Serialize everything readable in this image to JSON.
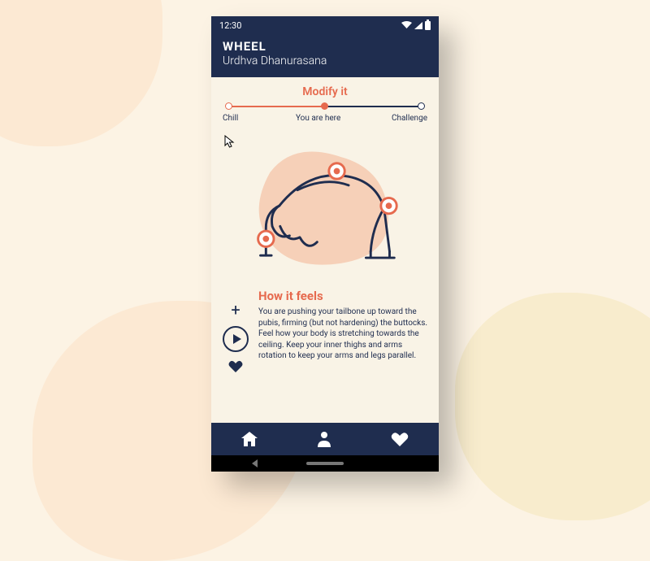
{
  "statusbar": {
    "time": "12:30"
  },
  "header": {
    "title": "WHEEL",
    "subtitle": "Urdhva Dhanurasana"
  },
  "difficulty": {
    "title": "Modify it",
    "labels": {
      "low": "Chill",
      "mid": "You are here",
      "high": "Challenge"
    }
  },
  "feels": {
    "heading": "How it feels",
    "body": "You are pushing your tailbone up toward the pubis, firming (but not hardening) the buttocks. Feel how your body is stretching towards the ceiling. Keep your inner thighs and arms rotation to keep your arms and legs parallel."
  },
  "colors": {
    "navy": "#1f2d4f",
    "accent": "#e66a4e",
    "cream": "#f9f3e6",
    "blob": "#f6d0b8"
  },
  "tabs": [
    "home",
    "profile",
    "favorites"
  ]
}
